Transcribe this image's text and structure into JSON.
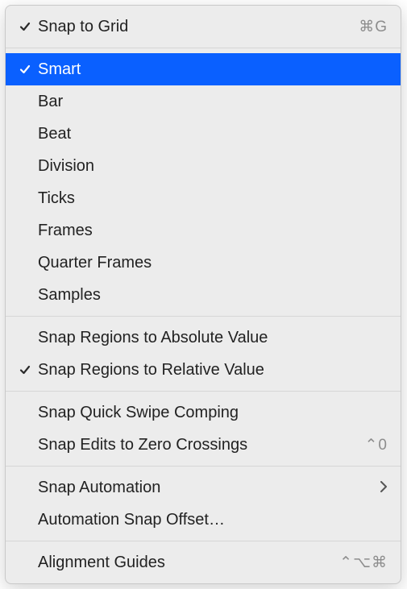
{
  "menu": {
    "sections": [
      {
        "items": [
          {
            "id": "snap-to-grid",
            "label": "Snap to Grid",
            "checked": true,
            "shortcutGlyphs": "⌘G"
          }
        ]
      },
      {
        "items": [
          {
            "id": "smart",
            "label": "Smart",
            "checked": true,
            "selected": true
          },
          {
            "id": "bar",
            "label": "Bar"
          },
          {
            "id": "beat",
            "label": "Beat"
          },
          {
            "id": "division",
            "label": "Division"
          },
          {
            "id": "ticks",
            "label": "Ticks"
          },
          {
            "id": "frames",
            "label": "Frames"
          },
          {
            "id": "quarter-frames",
            "label": "Quarter Frames"
          },
          {
            "id": "samples",
            "label": "Samples"
          }
        ]
      },
      {
        "items": [
          {
            "id": "snap-regions-absolute",
            "label": "Snap Regions to Absolute Value"
          },
          {
            "id": "snap-regions-relative",
            "label": "Snap Regions to Relative Value",
            "checked": true
          }
        ]
      },
      {
        "items": [
          {
            "id": "snap-quick-swipe-comping",
            "label": "Snap Quick Swipe Comping"
          },
          {
            "id": "snap-edits-zero-crossings",
            "label": "Snap Edits to Zero Crossings",
            "shortcutGlyphs": "⌃0"
          }
        ]
      },
      {
        "items": [
          {
            "id": "snap-automation",
            "label": "Snap Automation",
            "submenu": true
          },
          {
            "id": "automation-snap-offset",
            "label": "Automation Snap Offset…"
          }
        ]
      },
      {
        "items": [
          {
            "id": "alignment-guides",
            "label": "Alignment Guides",
            "shortcutGlyphs": "⌃⌥⌘"
          }
        ]
      }
    ]
  }
}
